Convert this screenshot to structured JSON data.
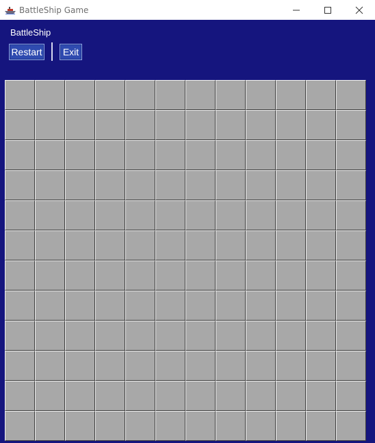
{
  "window": {
    "title": "BattleShip Game",
    "icon": "ship-icon",
    "controls": [
      "minimize-icon",
      "maximize-icon",
      "close-icon"
    ]
  },
  "header": {
    "title": "BattleShip"
  },
  "toolbar": {
    "restart_label": "Restart",
    "exit_label": "Exit"
  },
  "board": {
    "rows": 12,
    "cols": 12,
    "cell_state": "unrevealed"
  },
  "colors": {
    "background": "#15157e",
    "button": "#2f4bb0",
    "cell": "#a8a8a8"
  }
}
